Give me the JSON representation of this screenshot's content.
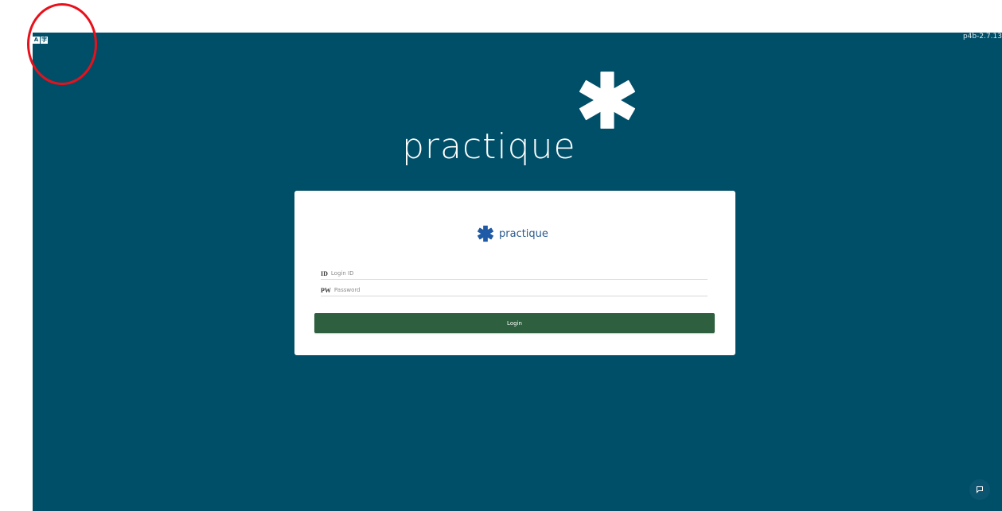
{
  "app": {
    "version": "p4b-2.7.13",
    "background_color": "#004f69",
    "language_switch": {
      "options": [
        "A",
        "字"
      ]
    }
  },
  "hero": {
    "brand": "practique",
    "star_color": "#ffffff"
  },
  "login_card": {
    "brand": "practique",
    "brand_color": "#2a5a8c",
    "star_color": "#1f5aa6",
    "id_field": {
      "label": "ID",
      "placeholder": "Login ID",
      "value": ""
    },
    "password_field": {
      "label": "PW",
      "placeholder": "Password",
      "value": ""
    },
    "login_button": {
      "label": "Login",
      "color": "#2e6040"
    }
  },
  "chat": {
    "icon": "chat-bubble-icon"
  },
  "annotation": {
    "color": "#e8101b"
  }
}
